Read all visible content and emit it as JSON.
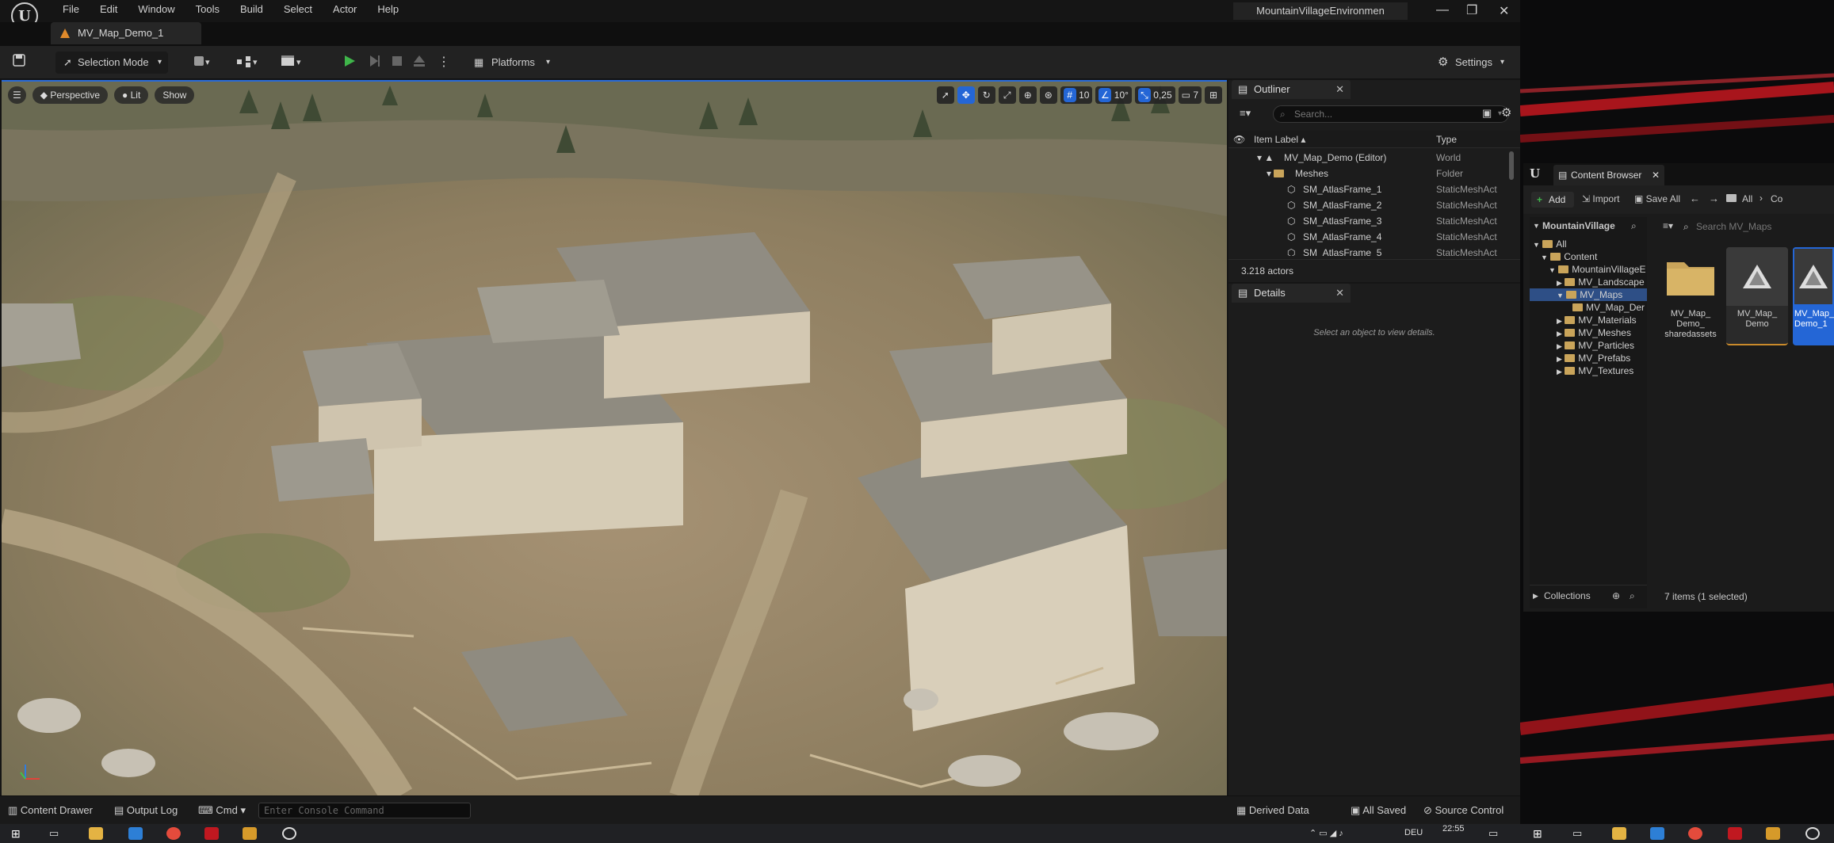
{
  "window": {
    "title": "MountainVillageEnvironmen",
    "menu": [
      "File",
      "Edit",
      "Window",
      "Tools",
      "Build",
      "Select",
      "Actor",
      "Help"
    ],
    "doc_tab": "MV_Map_Demo_1"
  },
  "toolbar": {
    "mode": "Selection Mode",
    "platforms": "Platforms",
    "settings": "Settings"
  },
  "viewport": {
    "perspective": "Perspective",
    "lit": "Lit",
    "show": "Show",
    "grid_snap": "10",
    "rotation_snap": "10°",
    "scale_snap": "0,25",
    "camera_speed": "7"
  },
  "outliner": {
    "title": "Outliner",
    "search_placeholder": "Search...",
    "col_label": "Item Label",
    "col_type": "Type",
    "rows": [
      {
        "label": "MV_Map_Demo (Editor)",
        "type": "World"
      },
      {
        "label": "Meshes",
        "type": "Folder"
      },
      {
        "label": "SM_AtlasFrame_1",
        "type": "StaticMeshAct"
      },
      {
        "label": "SM_AtlasFrame_2",
        "type": "StaticMeshAct"
      },
      {
        "label": "SM_AtlasFrame_3",
        "type": "StaticMeshAct"
      },
      {
        "label": "SM_AtlasFrame_4",
        "type": "StaticMeshAct"
      },
      {
        "label": "SM_AtlasFrame_5",
        "type": "StaticMeshAct"
      }
    ],
    "actor_count": "3.218 actors"
  },
  "details": {
    "title": "Details",
    "empty_message": "Select an object to view details."
  },
  "statusbar": {
    "content_drawer": "Content Drawer",
    "output_log": "Output Log",
    "cmd": "Cmd",
    "console_placeholder": "Enter Console Command",
    "derived_data": "Derived Data",
    "all_saved": "All Saved",
    "source_control": "Source Control"
  },
  "content_browser": {
    "title": "Content Browser",
    "add": "Add",
    "import": "Import",
    "save_all": "Save All",
    "path_all": "All",
    "path_next": "Co",
    "tree_root": "MountainVillage",
    "search_placeholder": "Search MV_Maps",
    "tree": [
      {
        "label": "All",
        "level": 0,
        "expanded": true
      },
      {
        "label": "Content",
        "level": 1,
        "expanded": true
      },
      {
        "label": "MountainVillageE",
        "level": 2,
        "expanded": true
      },
      {
        "label": "MV_Landscape",
        "level": 3,
        "expanded": false
      },
      {
        "label": "MV_Maps",
        "level": 3,
        "expanded": true,
        "selected": true
      },
      {
        "label": "MV_Map_Der",
        "level": 4,
        "expanded": false
      },
      {
        "label": "MV_Materials",
        "level": 3,
        "expanded": false
      },
      {
        "label": "MV_Meshes",
        "level": 3,
        "expanded": false
      },
      {
        "label": "MV_Particles",
        "level": 3,
        "expanded": false
      },
      {
        "label": "MV_Prefabs",
        "level": 3,
        "expanded": false
      },
      {
        "label": "MV_Textures",
        "level": 3,
        "expanded": false
      }
    ],
    "assets": [
      {
        "name": "MV_Map_\nDemo_\nsharedassets",
        "kind": "folder"
      },
      {
        "name": "MV_Map_\nDemo",
        "kind": "map"
      },
      {
        "name": "MV_Map_\nDemo_1",
        "kind": "map",
        "selected": true
      }
    ],
    "collections": "Collections",
    "items_status": "7 items (1 selected)"
  },
  "taskbar": {
    "lang": "DEU",
    "time": "22:55"
  },
  "colors": {
    "accent_blue": "#2466d6",
    "play_green": "#3fb54a",
    "folder": "#c9a45a"
  }
}
